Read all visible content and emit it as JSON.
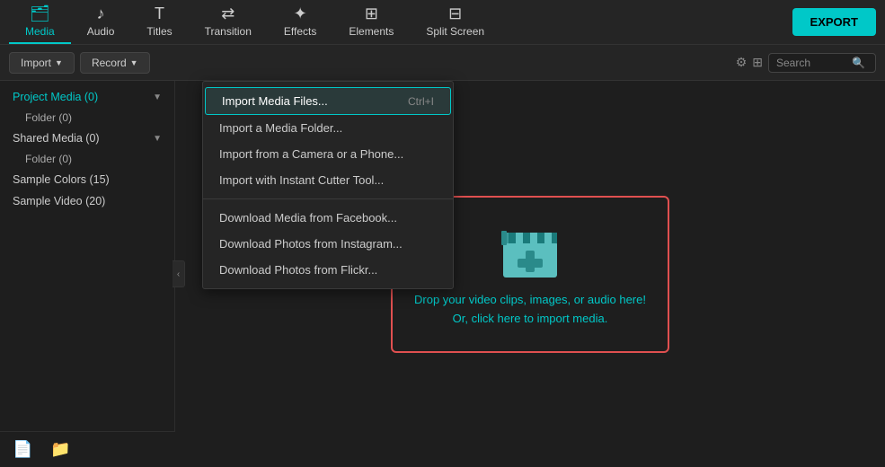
{
  "nav": {
    "items": [
      {
        "id": "media",
        "label": "Media",
        "icon": "🗂",
        "active": true
      },
      {
        "id": "audio",
        "label": "Audio",
        "icon": "♪"
      },
      {
        "id": "titles",
        "label": "Titles",
        "icon": "T"
      },
      {
        "id": "transition",
        "label": "Transition",
        "icon": "⇄"
      },
      {
        "id": "effects",
        "label": "Effects",
        "icon": "✦"
      },
      {
        "id": "elements",
        "label": "Elements",
        "icon": "⊞"
      },
      {
        "id": "splitscreen",
        "label": "Split Screen",
        "icon": "⊟"
      }
    ],
    "export_label": "EXPORT"
  },
  "toolbar": {
    "import_label": "Import",
    "record_label": "Record",
    "search_placeholder": "Search"
  },
  "sidebar": {
    "items": [
      {
        "id": "project-media",
        "label": "Project Media (0)",
        "count": 0,
        "expandable": true
      },
      {
        "id": "folder",
        "label": "Folder (0)",
        "count": 0,
        "sub": true
      },
      {
        "id": "shared-media",
        "label": "Shared Media (0)",
        "count": 0,
        "expandable": true
      },
      {
        "id": "folder2",
        "label": "Folder (0)",
        "count": 0,
        "sub": true
      },
      {
        "id": "sample-colors",
        "label": "Sample Colors (15)",
        "count": 15
      },
      {
        "id": "sample-video",
        "label": "Sample Video (20)",
        "count": 20
      }
    ],
    "footer_icons": [
      "add-file",
      "add-folder"
    ]
  },
  "import_menu": {
    "items": [
      {
        "id": "import-files",
        "label": "Import Media Files...",
        "shortcut": "Ctrl+I",
        "highlighted": true
      },
      {
        "id": "import-folder",
        "label": "Import a Media Folder..."
      },
      {
        "id": "import-camera",
        "label": "Import from a Camera or a Phone..."
      },
      {
        "id": "import-cutter",
        "label": "Import with Instant Cutter Tool..."
      },
      {
        "id": "divider"
      },
      {
        "id": "download-facebook",
        "label": "Download Media from Facebook..."
      },
      {
        "id": "download-instagram",
        "label": "Download Photos from Instagram..."
      },
      {
        "id": "download-flickr",
        "label": "Download Photos from Flickr..."
      }
    ]
  },
  "dropzone": {
    "line1": "Drop your video clips, images, or audio here!",
    "line2": "Or, click here to import media."
  },
  "collapse_arrow": "‹"
}
